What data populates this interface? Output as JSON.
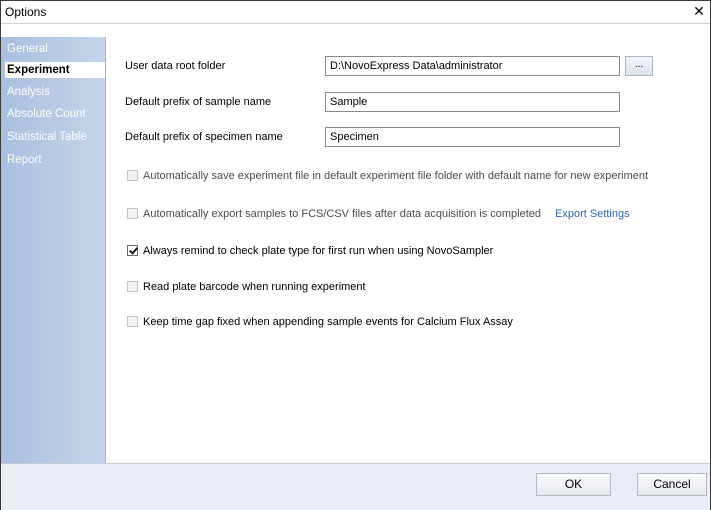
{
  "window": {
    "title": "Options",
    "close_glyph": "✕"
  },
  "sidebar": {
    "items": [
      {
        "label": "General",
        "active": false
      },
      {
        "label": "Experiment",
        "active": true
      },
      {
        "label": "Analysis",
        "active": false
      },
      {
        "label": "Absolute Count",
        "active": false
      },
      {
        "label": "Statistical Table",
        "active": false
      },
      {
        "label": "Report",
        "active": false
      }
    ]
  },
  "experiment": {
    "root_folder": {
      "label": "User data root folder",
      "value": "D:\\NovoExpress Data\\administrator",
      "browse_label": "..."
    },
    "sample_prefix": {
      "label": "Default prefix of sample name",
      "value": "Sample"
    },
    "specimen_prefix": {
      "label": "Default prefix of specimen name",
      "value": "Specimen"
    },
    "options": [
      {
        "label": "Automatically save experiment file in default experiment file folder with default name for new experiment",
        "checked": false,
        "enabled": false
      },
      {
        "label": "Automatically export samples to FCS/CSV files after data acquisition is completed",
        "checked": false,
        "enabled": false,
        "link": "Export Settings"
      },
      {
        "label": "Always remind to check plate type for first run when using NovoSampler",
        "checked": true,
        "enabled": true
      },
      {
        "label": "Read plate barcode when running experiment",
        "checked": false,
        "enabled": true
      },
      {
        "label": "Keep time gap fixed when appending sample events for Calcium Flux Assay",
        "checked": false,
        "enabled": true
      }
    ]
  },
  "footer": {
    "ok_label": "OK",
    "cancel_label": "Cancel"
  },
  "colors": {
    "sidebar": "#b8c9e4",
    "link": "#2f64b0",
    "footer": "#e9edf4"
  }
}
